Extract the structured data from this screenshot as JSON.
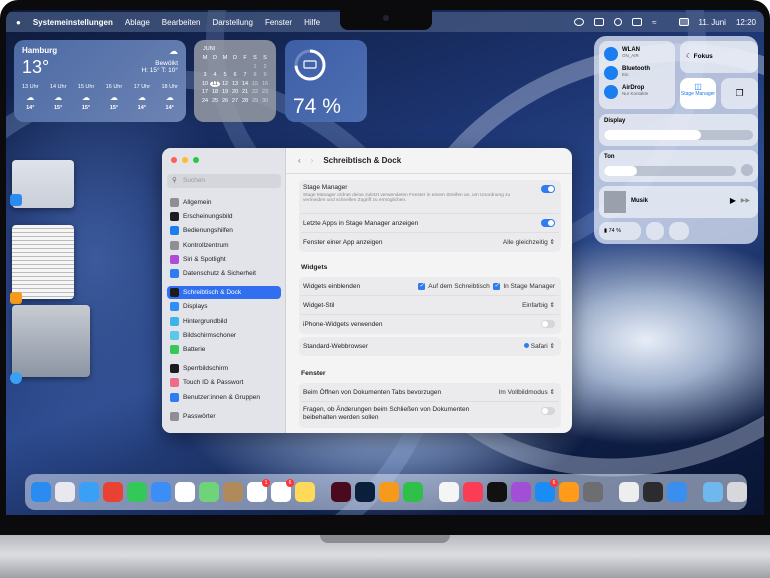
{
  "menubar": {
    "apple": "",
    "app": "Systemeinstellungen",
    "items": [
      "Ablage",
      "Bearbeiten",
      "Darstellung",
      "Fenster",
      "Hilfe"
    ],
    "date": "11. Juni",
    "time": "12:20"
  },
  "weather": {
    "city": "Hamburg",
    "temp": "13°",
    "condition": "Bewölkt",
    "hilo": "H: 15° T: 10°",
    "hours": [
      {
        "t": "13 Uhr",
        "v": "14°"
      },
      {
        "t": "14 Uhr",
        "v": "15°"
      },
      {
        "t": "15 Uhr",
        "v": "15°"
      },
      {
        "t": "16 Uhr",
        "v": "15°"
      },
      {
        "t": "17 Uhr",
        "v": "14°"
      },
      {
        "t": "18 Uhr",
        "v": "14°"
      }
    ]
  },
  "calendar": {
    "month": "JUNI",
    "weekdays": [
      "M",
      "D",
      "M",
      "D",
      "F",
      "S",
      "S"
    ],
    "days": [
      "",
      "",
      "",
      "",
      "",
      "1",
      "2",
      "3",
      "4",
      "5",
      "6",
      "7",
      "8",
      "9",
      "10",
      "11",
      "12",
      "13",
      "14",
      "15",
      "16",
      "17",
      "18",
      "19",
      "20",
      "21",
      "22",
      "23",
      "24",
      "25",
      "26",
      "27",
      "28",
      "29",
      "30"
    ],
    "today": "11"
  },
  "battery_widget": {
    "percent": "74 %",
    "level": 74
  },
  "control_center": {
    "wlan": "WLAN",
    "wlan_sub": "ON_AIR",
    "bluetooth": "Bluetooth",
    "bluetooth_sub": "Ein",
    "airdrop": "AirDrop",
    "airdrop_sub": "Nur Kontakte",
    "focus": "Fokus",
    "stage": "Stage Manager",
    "display": "Display",
    "display_level": 0.65,
    "sound": "Ton",
    "sound_level": 0.25,
    "music": "Musik",
    "battery": "74 %"
  },
  "settings": {
    "search_placeholder": "Suchen",
    "title": "Schreibtisch & Dock",
    "sidebar": [
      {
        "label": "Allgemein",
        "color": "#8e8e93"
      },
      {
        "label": "Erscheinungsbild",
        "color": "#1c1c1e"
      },
      {
        "label": "Bedienungshilfen",
        "color": "#1a7df0"
      },
      {
        "label": "Kontrollzentrum",
        "color": "#8e8e93"
      },
      {
        "label": "Siri & Spotlight",
        "color": "#b04ad8"
      },
      {
        "label": "Datenschutz & Sicherheit",
        "color": "#2f7bf0"
      },
      {
        "label": "Schreibtisch & Dock",
        "color": "#1c1c1e"
      },
      {
        "label": "Displays",
        "color": "#2f8df5"
      },
      {
        "label": "Hintergrundbild",
        "color": "#39b6e8"
      },
      {
        "label": "Bildschirmschoner",
        "color": "#5ac8e8"
      },
      {
        "label": "Batterie",
        "color": "#34c759"
      },
      {
        "label": "Sperrbildschirm",
        "color": "#1c1c1e"
      },
      {
        "label": "Touch ID & Passwort",
        "color": "#f06a8a"
      },
      {
        "label": "Benutzer:innen & Gruppen",
        "color": "#2f7bf0"
      },
      {
        "label": "Passwörter",
        "color": "#8e8e93"
      }
    ],
    "stage_manager": "Stage Manager",
    "stage_desc": "Stage Manager ordnet deine zuletzt verwendeten Fenster in einem Streifen an, um Unordnung zu vermeiden und schnellen Zugriff zu ermöglichen.",
    "stage_on": true,
    "recent_apps": "Letzte Apps in Stage Manager anzeigen",
    "recent_on": true,
    "windows_of_app": "Fenster einer App anzeigen",
    "windows_of_app_value": "Alle gleichzeitig",
    "widgets_header": "Widgets",
    "show_widgets": "Widgets einblenden",
    "on_desktop": "Auf dem Schreibtisch",
    "in_stage": "In Stage Manager",
    "widget_style": "Widget-Stil",
    "widget_style_value": "Einfarbig",
    "iphone_widgets": "iPhone-Widgets verwenden",
    "iphone_on": false,
    "browser": "Standard-Webbrowser",
    "browser_value": "Safari",
    "fenster_header": "Fenster",
    "tabs_pref": "Beim Öffnen von Dokumenten Tabs bevorzugen",
    "tabs_value": "Im Vollbildmodus",
    "ask_changes": "Fragen, ob Änderungen beim Schließen von Dokumenten beibehalten werden sollen",
    "ask_on": false
  },
  "dock": [
    {
      "name": "finder",
      "c": "#2a8cf0"
    },
    {
      "name": "launchpad",
      "c": "#e8e8ee"
    },
    {
      "name": "safari",
      "c": "#3aa0f5"
    },
    {
      "name": "chrome",
      "c": "#e94235"
    },
    {
      "name": "messages",
      "c": "#34c759"
    },
    {
      "name": "mail",
      "c": "#3b8ef5"
    },
    {
      "name": "slack",
      "c": "#ffffff"
    },
    {
      "name": "maps",
      "c": "#6fd37a"
    },
    {
      "name": "contacts",
      "c": "#b08a5a"
    },
    {
      "name": "calendar",
      "c": "#ffffff",
      "badge": "1"
    },
    {
      "name": "reminders",
      "c": "#ffffff",
      "badge": "6"
    },
    {
      "name": "notes",
      "c": "#ffd95a"
    },
    {
      "sep": true
    },
    {
      "name": "indesign",
      "c": "#4a0a1e"
    },
    {
      "name": "photoshop",
      "c": "#0a1f3a"
    },
    {
      "name": "pages",
      "c": "#f59a1a"
    },
    {
      "name": "numbers",
      "c": "#30c04a"
    },
    {
      "sep": true
    },
    {
      "name": "photos",
      "c": "#f5f5f5"
    },
    {
      "name": "music",
      "c": "#fa3c55"
    },
    {
      "name": "tv",
      "c": "#111111"
    },
    {
      "name": "podcasts",
      "c": "#a24fd8"
    },
    {
      "name": "app-store",
      "c": "#1a8cf5",
      "badge": "6"
    },
    {
      "name": "home",
      "c": "#ff9a1a"
    },
    {
      "name": "system-settings",
      "c": "#6d6d72"
    },
    {
      "sep": true
    },
    {
      "name": "preview",
      "c": "#eeeeee"
    },
    {
      "name": "phone",
      "c": "#2c2c2e"
    },
    {
      "name": "weather",
      "c": "#3a8ef0"
    },
    {
      "sep": true
    },
    {
      "name": "downloads-folder",
      "c": "#6fb8ee"
    },
    {
      "name": "trash",
      "c": "#d8d8dc"
    }
  ]
}
